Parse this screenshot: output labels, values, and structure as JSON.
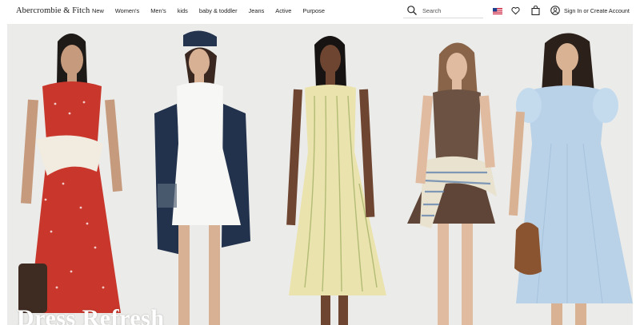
{
  "brand": {
    "logo_text": "Abercrombie & Fitch"
  },
  "nav": {
    "items": [
      {
        "label": "New"
      },
      {
        "label": "Women's"
      },
      {
        "label": "Men's"
      },
      {
        "label": "kids"
      },
      {
        "label": "baby & toddler"
      },
      {
        "label": "Jeans"
      },
      {
        "label": "Active"
      },
      {
        "label": "Purpose"
      }
    ]
  },
  "search": {
    "placeholder": "Search",
    "icon": "search-icon"
  },
  "utility": {
    "flag_icon": "us-flag-icon",
    "wishlist_icon": "heart-icon",
    "bag_icon": "shopping-bag-icon",
    "account_icon": "account-icon",
    "signin_label": "Sign In or Create Account"
  },
  "hero": {
    "title": "Dress Refresh",
    "background": "#ebebe9"
  }
}
